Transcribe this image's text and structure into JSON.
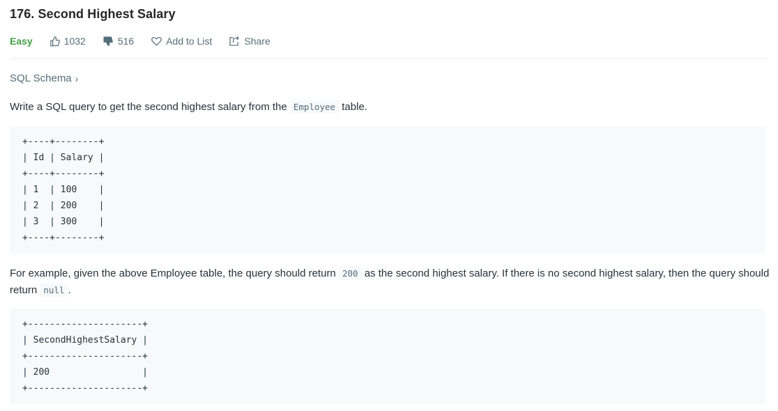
{
  "problem": {
    "title": "176. Second Highest Salary",
    "difficulty": "Easy",
    "likes": "1032",
    "dislikes": "516",
    "add_to_list": "Add to List",
    "share": "Share",
    "difficulty_color": "#43a047"
  },
  "schema_link": "SQL Schema",
  "description": {
    "p1_before": "Write a SQL query to get the second highest salary from the ",
    "p1_code": "Employee",
    "p1_after": " table.",
    "table_block": "+----+--------+\n| Id | Salary |\n+----+--------+\n| 1  | 100    |\n| 2  | 200    |\n| 3  | 300    |\n+----+--------+",
    "p2_before": "For example, given the above Employee table, the query should return ",
    "p2_code1": "200",
    "p2_mid": " as the second highest salary. If there is no second highest salary, then the query should return ",
    "p2_code2": "null",
    "p2_after": ".",
    "result_block": "+---------------------+\n| SecondHighestSalary |\n+---------------------+\n| 200                 |\n+---------------------+"
  },
  "icons": [
    "thumbs-up-icon",
    "thumbs-down-icon",
    "heart-icon",
    "share-icon",
    "chevron-right-icon"
  ]
}
